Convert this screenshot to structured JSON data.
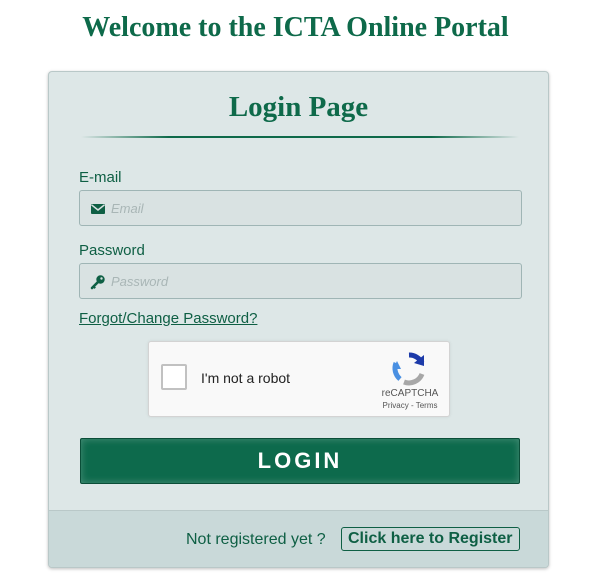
{
  "page": {
    "title": "Welcome to the ICTA Online Portal"
  },
  "login_card": {
    "title": "Login Page",
    "email": {
      "label": "E-mail",
      "placeholder": "Email",
      "icon": "envelope-icon"
    },
    "password": {
      "label": "Password",
      "placeholder": "Password",
      "icon": "key-icon"
    },
    "forgot_link": "Forgot/Change Password?",
    "captcha": {
      "label": "I'm not a robot",
      "brand": "reCAPTCHA",
      "terms": "Privacy - Terms",
      "icon": "recaptcha-icon"
    },
    "login_button": "LOGIN"
  },
  "footer": {
    "prompt": "Not registered yet ?",
    "register_button": "Click here to Register"
  },
  "colors": {
    "brand_green": "#0e6a4a",
    "card_bg": "#dde7e7",
    "footer_bg": "#c9d9d9"
  }
}
